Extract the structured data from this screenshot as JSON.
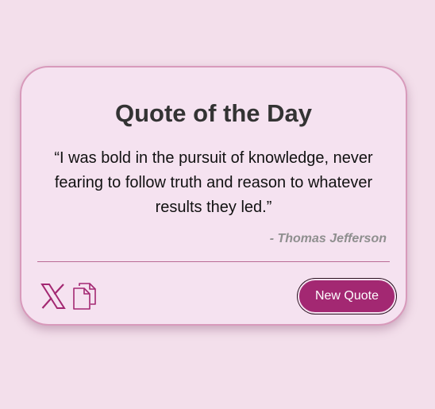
{
  "card": {
    "title": "Quote of the Day",
    "quote": "“I was bold in the pursuit of knowledge, never fearing to follow truth and reason to whatever results they led.”",
    "author": "- Thomas Jefferson"
  },
  "actions": {
    "share_icon": "x-logo-icon",
    "copy_icon": "copy-document-icon",
    "new_quote_label": "New Quote"
  },
  "colors": {
    "background": "#f3dfeb",
    "card": "#f5e2f0",
    "accent": "#a32872",
    "border": "#d89abb"
  }
}
